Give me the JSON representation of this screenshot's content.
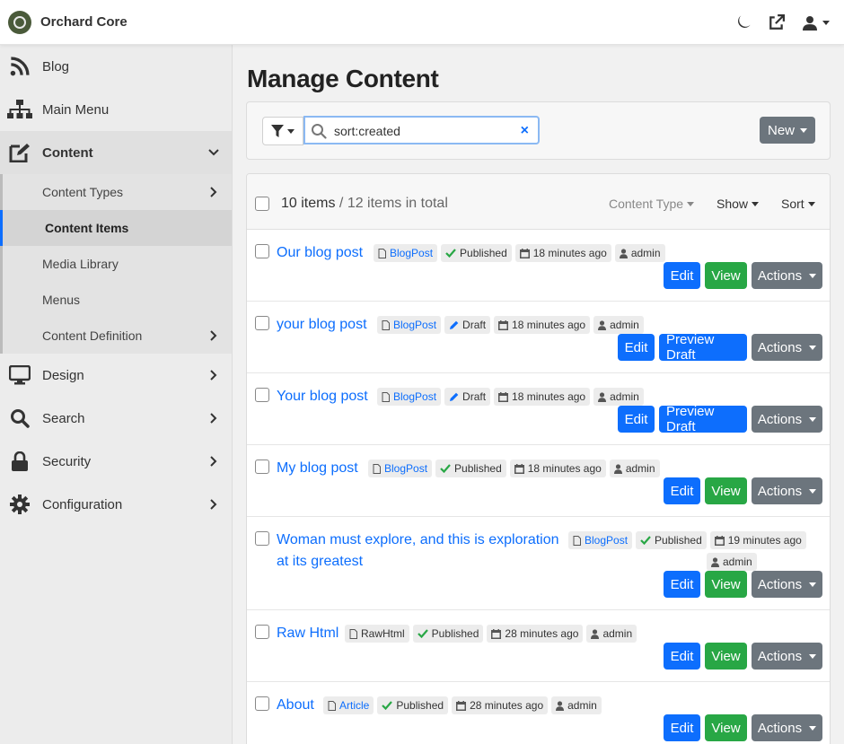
{
  "app": {
    "name": "Orchard Core"
  },
  "sidebar": {
    "items": [
      {
        "label": "Blog"
      },
      {
        "label": "Main Menu"
      },
      {
        "label": "Content"
      },
      {
        "label": "Design"
      },
      {
        "label": "Search"
      },
      {
        "label": "Security"
      },
      {
        "label": "Configuration"
      }
    ],
    "content_sub": [
      {
        "label": "Content Types"
      },
      {
        "label": "Content Items"
      },
      {
        "label": "Media Library"
      },
      {
        "label": "Menus"
      },
      {
        "label": "Content Definition"
      }
    ]
  },
  "page": {
    "title": "Manage Content"
  },
  "filter": {
    "search_value": "sort:created",
    "new_label": "New"
  },
  "list": {
    "count": "10 items",
    "total": "/ 12 items in total",
    "content_type_label": "Content Type",
    "show_label": "Show",
    "sort_label": "Sort",
    "items": [
      {
        "title": "Our blog post",
        "type": "BlogPost",
        "status": "Published",
        "time": "18 minutes ago",
        "author": "admin",
        "primary": "Edit",
        "secondary": "View",
        "actions": "Actions"
      },
      {
        "title": "your blog post",
        "type": "BlogPost",
        "status": "Draft",
        "time": "18 minutes ago",
        "author": "admin",
        "primary": "Edit",
        "secondary": "Preview Draft",
        "actions": "Actions"
      },
      {
        "title": "Your blog post",
        "type": "BlogPost",
        "status": "Draft",
        "time": "18 minutes ago",
        "author": "admin",
        "primary": "Edit",
        "secondary": "Preview Draft",
        "actions": "Actions"
      },
      {
        "title": "My blog post",
        "type": "BlogPost",
        "status": "Published",
        "time": "18 minutes ago",
        "author": "admin",
        "primary": "Edit",
        "secondary": "View",
        "actions": "Actions"
      },
      {
        "title_line1": "Woman must explore, and this is exploration",
        "title_line2": "at its greatest",
        "type": "BlogPost",
        "status": "Published",
        "time": "19 minutes ago",
        "author": "admin",
        "primary": "Edit",
        "secondary": "View",
        "actions": "Actions"
      },
      {
        "title": "Raw Html",
        "type": "RawHtml",
        "status": "Published",
        "time": "28 minutes ago",
        "author": "admin",
        "primary": "Edit",
        "secondary": "View",
        "actions": "Actions"
      },
      {
        "title": "About",
        "type": "Article",
        "status": "Published",
        "time": "28 minutes ago",
        "author": "admin",
        "primary": "Edit",
        "secondary": "View",
        "actions": "Actions"
      }
    ]
  },
  "colors": {
    "primary": "#0d6efd",
    "success": "#28a745",
    "secondary": "#6c757d"
  }
}
